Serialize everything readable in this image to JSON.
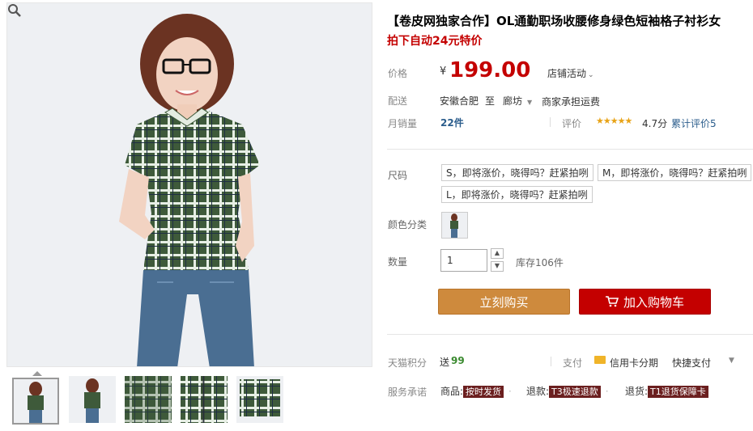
{
  "product": {
    "title": "【卷皮网独家合作】OL通勤职场收腰修身绿色短袖格子衬衫女",
    "subtitle": "拍下自动24元特价"
  },
  "price": {
    "label": "价格",
    "currency": "¥",
    "value": "199.00",
    "promo": "店铺活动"
  },
  "shipping": {
    "label": "配送",
    "from": "安徽合肥",
    "to_word": "至",
    "to": "廊坊",
    "fee": "商家承担运费"
  },
  "sales": {
    "label": "月销量",
    "value": "22件",
    "rating_label": "评价",
    "score": "4.7分",
    "reviews": "累计评价5"
  },
  "sizes": {
    "label": "尺码",
    "options": [
      "S，即将涨价，晓得吗？赶紧拍咧",
      "M，即将涨价，晓得吗？赶紧拍咧",
      "L，即将涨价，晓得吗？赶紧拍咧"
    ]
  },
  "color": {
    "label": "颜色分类"
  },
  "quantity": {
    "label": "数量",
    "value": "1",
    "stock": "库存106件"
  },
  "buttons": {
    "buy": "立刻购买",
    "cart": "加入购物车"
  },
  "points": {
    "label": "天猫积分",
    "prefix": "送",
    "value": "99",
    "pay_label": "支付",
    "pay_card": "信用卡分期",
    "pay_quick": "快捷支付"
  },
  "service": {
    "label": "服务承诺",
    "item1_label": "商品:",
    "item1_tag": "按时发货",
    "item2_label": "退款:",
    "item2_tag": "T3极速退款",
    "item3_label": "退货:",
    "item3_tag": "T1退货保障卡"
  },
  "colors": {
    "price_red": "#c40000",
    "buy_orange": "#ce8a3d",
    "cart_red": "#c40000",
    "link_blue": "#2b5d8c"
  }
}
